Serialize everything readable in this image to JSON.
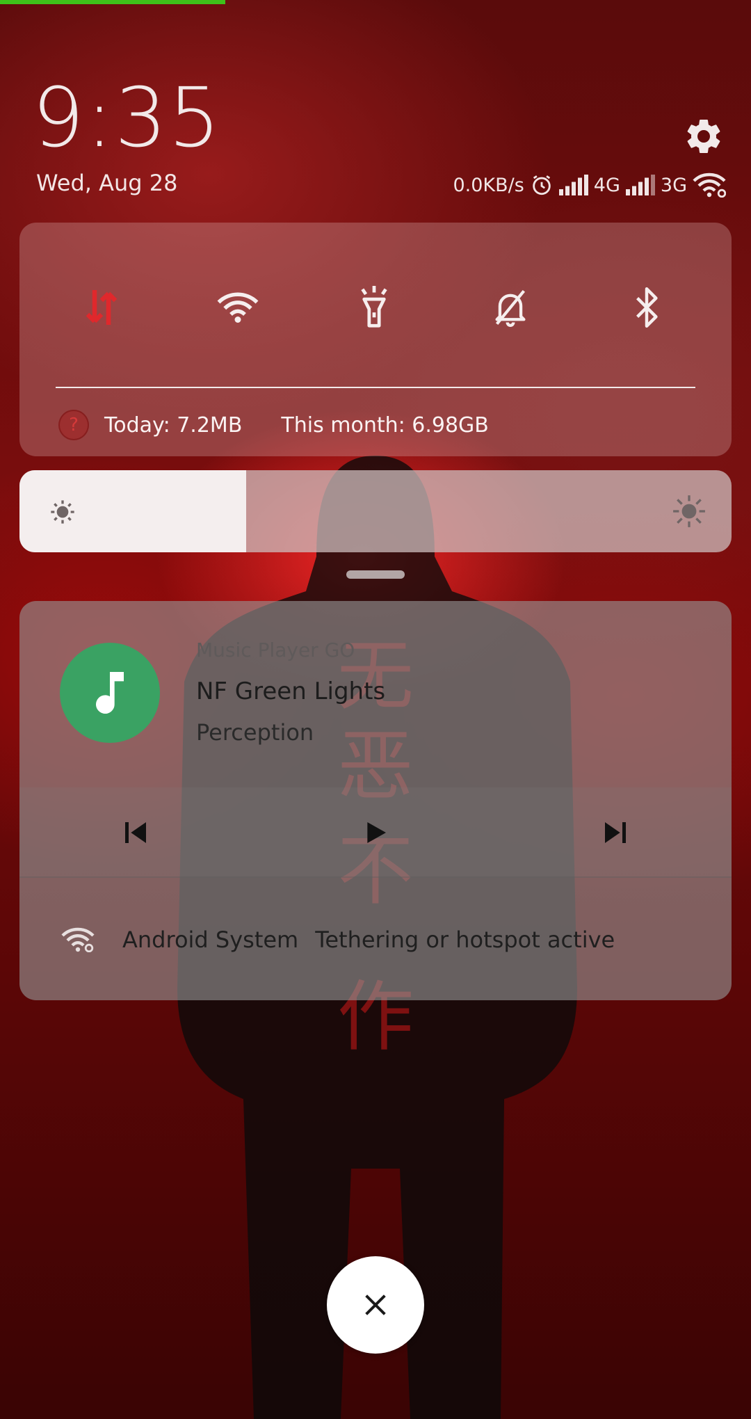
{
  "time": "9:35",
  "date": "Wed, Aug 28",
  "status_bar": {
    "network_speed": "0.0KB/s",
    "sim1_type": "4G",
    "sim2_type": "3G",
    "icons": [
      "alarm-icon",
      "signal-icon",
      "signal-icon",
      "wifi-hotspot-icon"
    ]
  },
  "quick_toggles": [
    {
      "name": "mobile-data",
      "icon": "data-arrows-icon",
      "active": true
    },
    {
      "name": "wifi",
      "icon": "wifi-icon",
      "active": false
    },
    {
      "name": "flashlight",
      "icon": "flashlight-icon",
      "active": false
    },
    {
      "name": "silent",
      "icon": "bell-off-icon",
      "active": false
    },
    {
      "name": "bluetooth",
      "icon": "bluetooth-icon",
      "active": false
    }
  ],
  "data_usage": {
    "today": "Today: 7.2MB",
    "month": "This month: 6.98GB"
  },
  "brightness": {
    "level": 0.318
  },
  "music_notification": {
    "app_name": "Music Player GO",
    "title": "NF Green Lights",
    "artist": "Perception",
    "art_color": "#3aa263"
  },
  "tether_notification": {
    "source": "Android System",
    "text": "Tethering or hotspot active"
  },
  "colors": {
    "accent_red": "#e0282c",
    "panel_tint": "#d7aaaa",
    "progress_green": "#3ec11a"
  }
}
